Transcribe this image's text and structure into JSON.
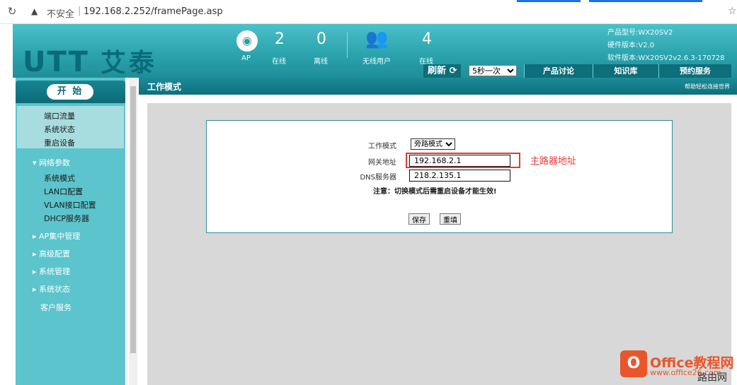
{
  "browser": {
    "reload_icon": "reload-icon",
    "warning_icon": "warning-triangle-icon",
    "insecure_label": "不安全",
    "separator": "|",
    "url": "192.168.2.252/framePage.asp",
    "star_icon": "star-icon"
  },
  "header": {
    "logo_latin": "UTT",
    "logo_cn": "艾泰",
    "ap": {
      "icon": "wifi-icon",
      "label": "AP"
    },
    "ap_online": {
      "value": "2",
      "label": "在线"
    },
    "ap_offline": {
      "value": "0",
      "label": "离线"
    },
    "wireless_users": {
      "icon": "users-icon",
      "label": "无线用户"
    },
    "users_online": {
      "value": "4",
      "label": "在线"
    },
    "product_model": "产品型号:WX20SV2",
    "hardware_version": "硬件版本:V2.0",
    "software_version": "软件版本:WX20SV2v2.6.3-170728",
    "refresh_label": "刷新",
    "refresh_icon": "refresh-icon",
    "refresh_interval": "5秒一次",
    "tabs": [
      "产品讨论",
      "知识库",
      "预约服务"
    ]
  },
  "sidebar": {
    "start_label": "开 始",
    "top_items": [
      "端口流量",
      "系统状态",
      "重启设备"
    ],
    "network_group": "网络参数",
    "network_items": [
      "系统模式",
      "LAN口配置",
      "VLAN接口配置",
      "DHCP服务器"
    ],
    "groups": [
      "AP集中管理",
      "高级配置",
      "系统管理",
      "系统状态"
    ],
    "customer_service": "客户服务"
  },
  "page": {
    "title": "工作模式",
    "help_link": "帮助轻松连接世界",
    "form": {
      "mode_label": "工作模式",
      "mode_value": "旁路模式",
      "gateway_label": "网关地址",
      "gateway_value": "192.168.2.1",
      "dns_label": "DNS服务器",
      "dns_value": "218.2.135.1",
      "notice": "注意：切换模式后需重启设备才能生效!",
      "save_label": "保存",
      "reset_label": "重填"
    },
    "annotation": "主路器地址"
  },
  "watermark": {
    "logo_letter": "O",
    "brand": "Office教程网",
    "url": "www.office26.com",
    "extra": "路由网"
  },
  "colors": {
    "header_teal": "#2ba4ae",
    "dark_teal": "#0e6e7a",
    "sidebar_teal": "#5bc4cc",
    "annotation_red": "#e53935",
    "watermark_orange": "#e8562a"
  }
}
